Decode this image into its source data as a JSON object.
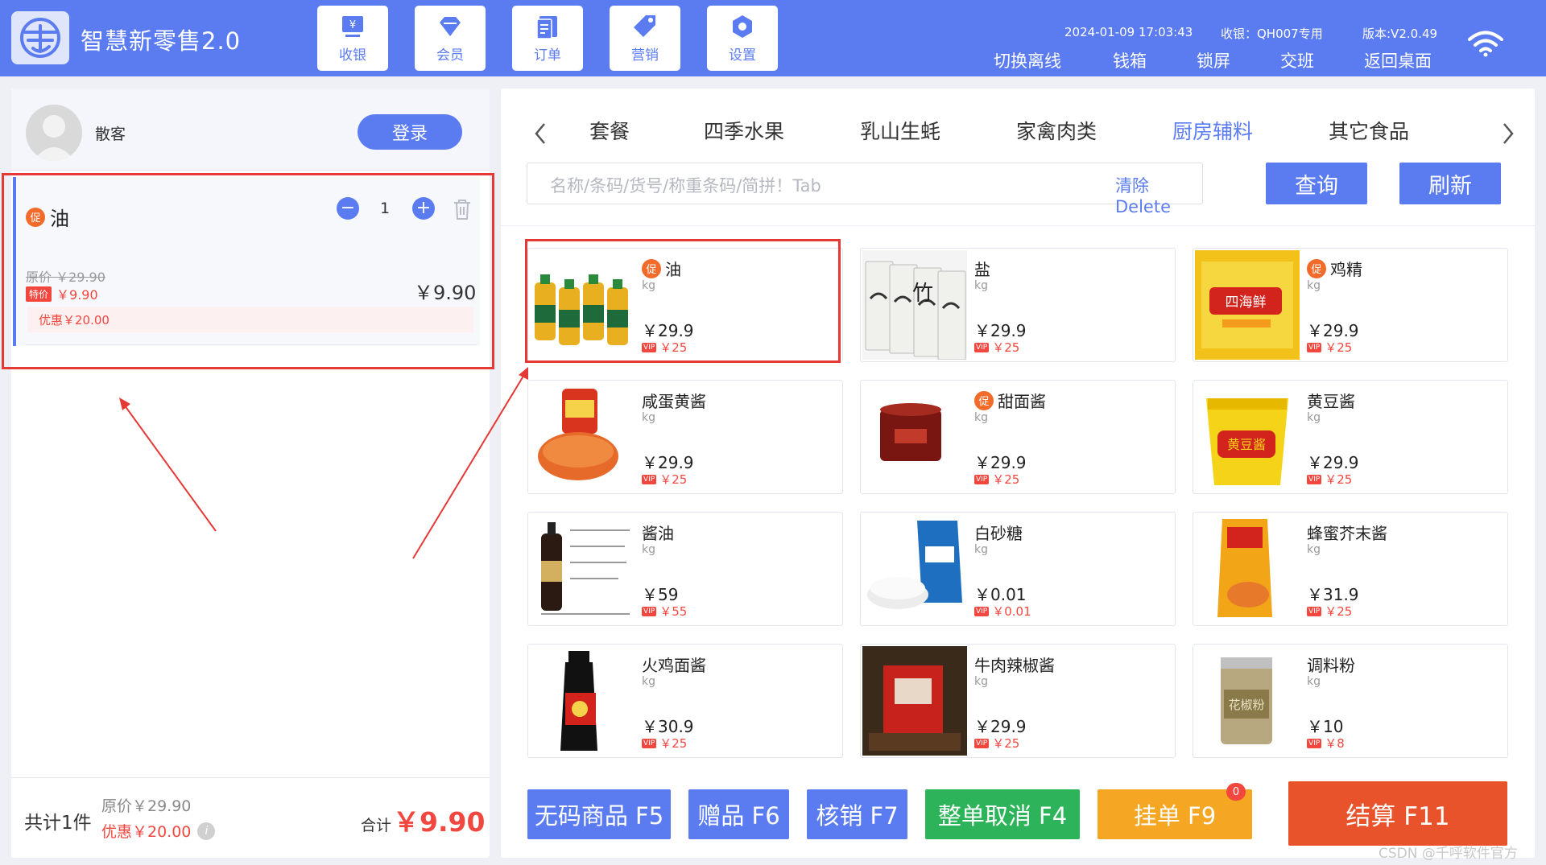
{
  "app": {
    "title": "智慧新零售2.0"
  },
  "nav": [
    {
      "label": "收银",
      "icon": "cashier-icon"
    },
    {
      "label": "会员",
      "icon": "diamond-icon"
    },
    {
      "label": "订单",
      "icon": "order-icon"
    },
    {
      "label": "营销",
      "icon": "tag-icon"
    },
    {
      "label": "设置",
      "icon": "settings-icon"
    }
  ],
  "status": {
    "datetime": "2024-01-09 17:03:43",
    "cashier": "收银：QH007专用",
    "version": "版本:V2.0.49"
  },
  "actions": [
    "切换离线",
    "钱箱",
    "锁屏",
    "交班",
    "返回桌面"
  ],
  "customer": {
    "name": "散客",
    "login_label": "登录"
  },
  "cart": {
    "item": {
      "promo": "促",
      "name": "油",
      "qty": "1",
      "orig_price": "原价 ￥29.90",
      "special_tag": "特价",
      "special_price": "￥9.90",
      "price": "￥9.90",
      "discount": "优惠￥20.00"
    }
  },
  "footer": {
    "count": "共计1件",
    "orig": "原价￥29.90",
    "disc": "优惠￥20.00",
    "sum_label": "合计",
    "sum_value": "￥9.90"
  },
  "categories": [
    "套餐",
    "四季水果",
    "乳山生蚝",
    "家禽肉类",
    "厨房辅料",
    "其它食品"
  ],
  "active_category": "厨房辅料",
  "search": {
    "placeholder": "名称/条码/货号/称重条码/简拼！Tab",
    "clear_label": "清除Delete"
  },
  "buttons": {
    "query": "查询",
    "refresh": "刷新"
  },
  "products": [
    {
      "name": "油",
      "promo": "促",
      "unit": "kg",
      "price": "￥29.9",
      "vip": "￥25",
      "img": "oil"
    },
    {
      "name": "盐",
      "promo": "",
      "unit": "kg",
      "price": "￥29.9",
      "vip": "￥25",
      "img": "salt"
    },
    {
      "name": "鸡精",
      "promo": "促",
      "unit": "kg",
      "price": "￥29.9",
      "vip": "￥25",
      "img": "chicken"
    },
    {
      "name": "咸蛋黄酱",
      "promo": "",
      "unit": "kg",
      "price": "￥29.9",
      "vip": "￥25",
      "img": "yolk"
    },
    {
      "name": "甜面酱",
      "promo": "促",
      "unit": "kg",
      "price": "￥29.9",
      "vip": "￥25",
      "img": "sweet"
    },
    {
      "name": "黄豆酱",
      "promo": "",
      "unit": "kg",
      "price": "￥29.9",
      "vip": "￥25",
      "img": "soybean"
    },
    {
      "name": "酱油",
      "promo": "",
      "unit": "kg",
      "price": "￥59",
      "vip": "￥55",
      "img": "soy"
    },
    {
      "name": "白砂糖",
      "promo": "",
      "unit": "kg",
      "price": "￥0.01",
      "vip": "￥0.01",
      "img": "sugar"
    },
    {
      "name": "蜂蜜芥末酱",
      "promo": "",
      "unit": "kg",
      "price": "￥31.9",
      "vip": "￥25",
      "img": "mustard"
    },
    {
      "name": "火鸡面酱",
      "promo": "",
      "unit": "kg",
      "price": "￥30.9",
      "vip": "￥25",
      "img": "turkey"
    },
    {
      "name": "牛肉辣椒酱",
      "promo": "",
      "unit": "kg",
      "price": "￥29.9",
      "vip": "￥25",
      "img": "beef"
    },
    {
      "name": "调料粉",
      "promo": "",
      "unit": "kg",
      "price": "￥10",
      "vip": "￥8",
      "img": "powder"
    }
  ],
  "vip_label": "VIP",
  "bottom_buttons": [
    {
      "label": "无码商品 F5",
      "color": "#5b7cf0"
    },
    {
      "label": "赠品 F6",
      "color": "#5b7cf0"
    },
    {
      "label": "核销 F7",
      "color": "#5b7cf0"
    },
    {
      "label": "整单取消 F4",
      "color": "#2db45a"
    },
    {
      "label": "挂单 F9",
      "color": "#f5a623",
      "badge": "0"
    },
    {
      "label": "结算 F11",
      "color": "#e8532b"
    }
  ],
  "watermark": "CSDN @千呼软件官方"
}
